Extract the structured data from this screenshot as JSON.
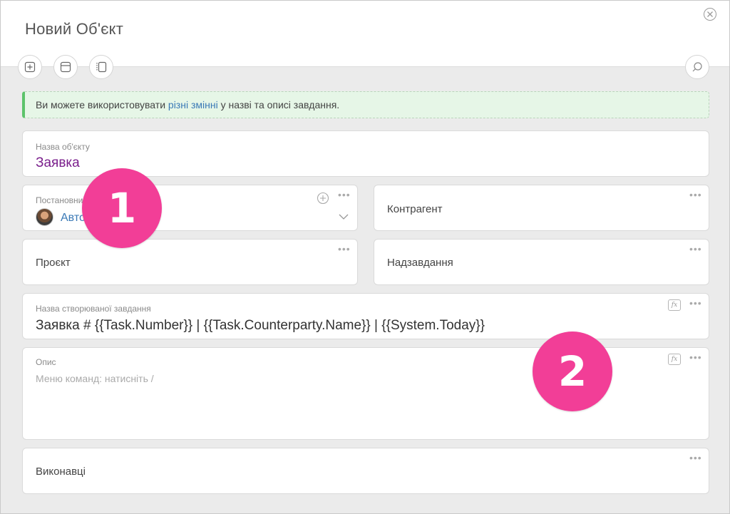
{
  "window": {
    "title": "Новий Об'єкт"
  },
  "notice": {
    "text_before": "Ви можете використовувати ",
    "link": "різні змінні",
    "text_after": " у назві та описі завдання."
  },
  "fields": {
    "object_name": {
      "label": "Назва об'єкту",
      "value": "Заявка"
    },
    "creator": {
      "label": "Постановник",
      "value": "Авто"
    },
    "counterparty": {
      "placeholder": "Контрагент"
    },
    "project": {
      "placeholder": "Проєкт"
    },
    "parent_task": {
      "placeholder": "Надзавдання"
    },
    "task_name": {
      "label": "Назва створюваної завдання",
      "value": "Заявка # {{Task.Number}} | {{Task.Counterparty.Name}} | {{System.Today}}"
    },
    "description": {
      "label": "Опис",
      "placeholder": "Меню команд: натисніть /"
    },
    "assignees": {
      "placeholder": "Виконавці"
    }
  },
  "badges": {
    "one": "1",
    "two": "2"
  },
  "icons": {
    "close": "close-circle-icon",
    "add_block": "add-block-icon",
    "layout": "layout-icon",
    "sidebar": "sidebar-icon",
    "search": "search-icon",
    "add": "add-circle-icon",
    "more": "more-dots-icon",
    "formula": "fx-icon",
    "dropdown": "chevron-down-icon"
  },
  "colors": {
    "accent_purple": "#7a1f8c",
    "link_blue": "#3a79b6",
    "badge_pink": "#f23e97",
    "notice_green": "#5cc36a"
  }
}
